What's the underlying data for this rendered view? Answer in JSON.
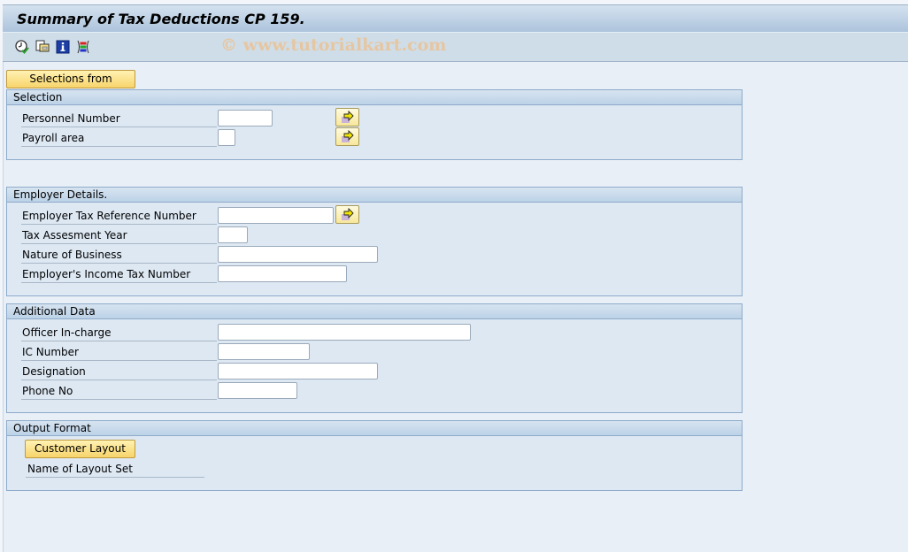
{
  "window": {
    "title": "Summary of Tax Deductions CP 159.",
    "watermark": "© www.tutorialkart.com"
  },
  "toolbar": {
    "icons": [
      {
        "name": "execute-icon",
        "label": "Execute"
      },
      {
        "name": "get-variant-icon",
        "label": "Get Variant"
      },
      {
        "name": "info-icon",
        "label": "Program Documentation"
      },
      {
        "name": "dynamic-selections-icon",
        "label": "Dynamic Selections"
      }
    ]
  },
  "selections_from_button": "Selections from",
  "groups": {
    "selection": {
      "title": "Selection",
      "fields": [
        {
          "label": "Personnel Number",
          "value": ""
        },
        {
          "label": "Payroll area",
          "value": ""
        }
      ]
    },
    "employer": {
      "title": "Employer Details.",
      "fields": [
        {
          "label": "Employer Tax Reference Number",
          "value": ""
        },
        {
          "label": "Tax Assesment Year",
          "value": ""
        },
        {
          "label": "Nature of Business",
          "value": ""
        },
        {
          "label": "Employer's Income Tax Number",
          "value": ""
        }
      ]
    },
    "additional": {
      "title": "Additional Data",
      "fields": [
        {
          "label": "Officer In-charge",
          "value": ""
        },
        {
          "label": "IC Number",
          "value": ""
        },
        {
          "label": "Designation",
          "value": ""
        },
        {
          "label": "Phone No",
          "value": ""
        }
      ]
    },
    "output": {
      "title": "Output Format",
      "customer_layout_button": "Customer Layout",
      "layout_set_label": "Name of Layout Set"
    }
  },
  "colors": {
    "button_gradient_top": "#fff2b3",
    "button_gradient_bottom": "#f7d46b",
    "group_border": "#8eabca",
    "background": "#e8eff7"
  }
}
